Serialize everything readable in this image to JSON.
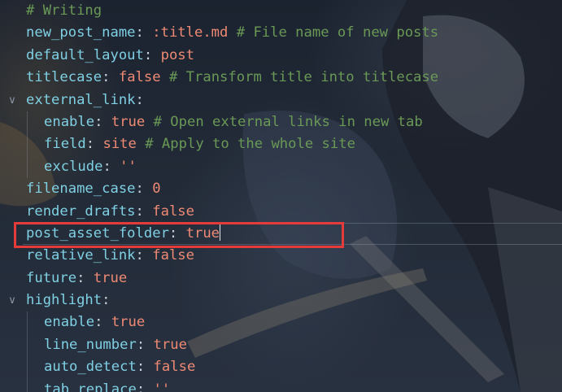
{
  "editor": {
    "lines": [
      {
        "indent": 0,
        "fold": false,
        "key": "# Writing",
        "keyIsComment": true
      },
      {
        "indent": 0,
        "fold": false,
        "key": "new_post_name",
        "value": ":title.md",
        "comment": "# File name of new posts"
      },
      {
        "indent": 0,
        "fold": false,
        "key": "default_layout",
        "value": "post"
      },
      {
        "indent": 0,
        "fold": false,
        "key": "titlecase",
        "value": "false",
        "comment": "# Transform title into titlecase"
      },
      {
        "indent": 0,
        "fold": true,
        "key": "external_link",
        "value": ""
      },
      {
        "indent": 1,
        "fold": false,
        "key": "enable",
        "value": "true",
        "comment": "# Open external links in new tab"
      },
      {
        "indent": 1,
        "fold": false,
        "key": "field",
        "value": "site",
        "comment": "# Apply to the whole site"
      },
      {
        "indent": 1,
        "fold": false,
        "key": "exclude",
        "value": "''"
      },
      {
        "indent": 0,
        "fold": false,
        "key": "filename_case",
        "value": "0"
      },
      {
        "indent": 0,
        "fold": false,
        "key": "render_drafts",
        "value": "false"
      },
      {
        "indent": 0,
        "fold": false,
        "key": "post_asset_folder",
        "value": "true",
        "current": true
      },
      {
        "indent": 0,
        "fold": false,
        "key": "relative_link",
        "value": "false"
      },
      {
        "indent": 0,
        "fold": false,
        "key": "future",
        "value": "true"
      },
      {
        "indent": 0,
        "fold": true,
        "key": "highlight",
        "value": ""
      },
      {
        "indent": 1,
        "fold": false,
        "key": "enable",
        "value": "true"
      },
      {
        "indent": 1,
        "fold": false,
        "key": "line_number",
        "value": "true"
      },
      {
        "indent": 1,
        "fold": false,
        "key": "auto_detect",
        "value": "false"
      },
      {
        "indent": 1,
        "fold": false,
        "key": "tab_replace",
        "value": "''"
      }
    ],
    "fold_icon": "chevron-down-icon",
    "highlight_color": "#e63b3b"
  }
}
